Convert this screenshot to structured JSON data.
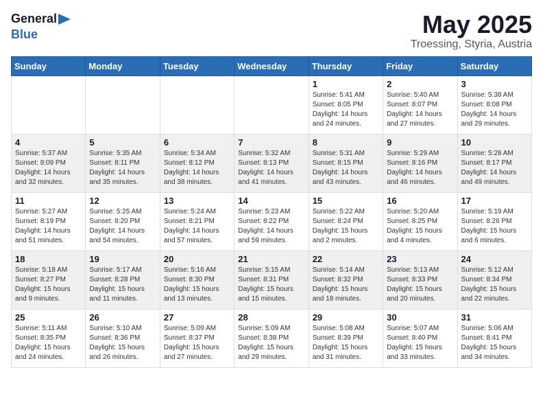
{
  "header": {
    "logo_general": "General",
    "logo_blue": "Blue",
    "month_title": "May 2025",
    "location": "Troessing, Styria, Austria"
  },
  "weekdays": [
    "Sunday",
    "Monday",
    "Tuesday",
    "Wednesday",
    "Thursday",
    "Friday",
    "Saturday"
  ],
  "weeks": [
    [
      {
        "day": "",
        "sunrise": "",
        "sunset": "",
        "daylight": ""
      },
      {
        "day": "",
        "sunrise": "",
        "sunset": "",
        "daylight": ""
      },
      {
        "day": "",
        "sunrise": "",
        "sunset": "",
        "daylight": ""
      },
      {
        "day": "",
        "sunrise": "",
        "sunset": "",
        "daylight": ""
      },
      {
        "day": "1",
        "sunrise": "Sunrise: 5:41 AM",
        "sunset": "Sunset: 8:05 PM",
        "daylight": "Daylight: 14 hours and 24 minutes."
      },
      {
        "day": "2",
        "sunrise": "Sunrise: 5:40 AM",
        "sunset": "Sunset: 8:07 PM",
        "daylight": "Daylight: 14 hours and 27 minutes."
      },
      {
        "day": "3",
        "sunrise": "Sunrise: 5:38 AM",
        "sunset": "Sunset: 8:08 PM",
        "daylight": "Daylight: 14 hours and 29 minutes."
      }
    ],
    [
      {
        "day": "4",
        "sunrise": "Sunrise: 5:37 AM",
        "sunset": "Sunset: 8:09 PM",
        "daylight": "Daylight: 14 hours and 32 minutes."
      },
      {
        "day": "5",
        "sunrise": "Sunrise: 5:35 AM",
        "sunset": "Sunset: 8:11 PM",
        "daylight": "Daylight: 14 hours and 35 minutes."
      },
      {
        "day": "6",
        "sunrise": "Sunrise: 5:34 AM",
        "sunset": "Sunset: 8:12 PM",
        "daylight": "Daylight: 14 hours and 38 minutes."
      },
      {
        "day": "7",
        "sunrise": "Sunrise: 5:32 AM",
        "sunset": "Sunset: 8:13 PM",
        "daylight": "Daylight: 14 hours and 41 minutes."
      },
      {
        "day": "8",
        "sunrise": "Sunrise: 5:31 AM",
        "sunset": "Sunset: 8:15 PM",
        "daylight": "Daylight: 14 hours and 43 minutes."
      },
      {
        "day": "9",
        "sunrise": "Sunrise: 5:29 AM",
        "sunset": "Sunset: 8:16 PM",
        "daylight": "Daylight: 14 hours and 46 minutes."
      },
      {
        "day": "10",
        "sunrise": "Sunrise: 5:28 AM",
        "sunset": "Sunset: 8:17 PM",
        "daylight": "Daylight: 14 hours and 49 minutes."
      }
    ],
    [
      {
        "day": "11",
        "sunrise": "Sunrise: 5:27 AM",
        "sunset": "Sunset: 8:19 PM",
        "daylight": "Daylight: 14 hours and 51 minutes."
      },
      {
        "day": "12",
        "sunrise": "Sunrise: 5:25 AM",
        "sunset": "Sunset: 8:20 PM",
        "daylight": "Daylight: 14 hours and 54 minutes."
      },
      {
        "day": "13",
        "sunrise": "Sunrise: 5:24 AM",
        "sunset": "Sunset: 8:21 PM",
        "daylight": "Daylight: 14 hours and 57 minutes."
      },
      {
        "day": "14",
        "sunrise": "Sunrise: 5:23 AM",
        "sunset": "Sunset: 8:22 PM",
        "daylight": "Daylight: 14 hours and 59 minutes."
      },
      {
        "day": "15",
        "sunrise": "Sunrise: 5:22 AM",
        "sunset": "Sunset: 8:24 PM",
        "daylight": "Daylight: 15 hours and 2 minutes."
      },
      {
        "day": "16",
        "sunrise": "Sunrise: 5:20 AM",
        "sunset": "Sunset: 8:25 PM",
        "daylight": "Daylight: 15 hours and 4 minutes."
      },
      {
        "day": "17",
        "sunrise": "Sunrise: 5:19 AM",
        "sunset": "Sunset: 8:26 PM",
        "daylight": "Daylight: 15 hours and 6 minutes."
      }
    ],
    [
      {
        "day": "18",
        "sunrise": "Sunrise: 5:18 AM",
        "sunset": "Sunset: 8:27 PM",
        "daylight": "Daylight: 15 hours and 9 minutes."
      },
      {
        "day": "19",
        "sunrise": "Sunrise: 5:17 AM",
        "sunset": "Sunset: 8:28 PM",
        "daylight": "Daylight: 15 hours and 11 minutes."
      },
      {
        "day": "20",
        "sunrise": "Sunrise: 5:16 AM",
        "sunset": "Sunset: 8:30 PM",
        "daylight": "Daylight: 15 hours and 13 minutes."
      },
      {
        "day": "21",
        "sunrise": "Sunrise: 5:15 AM",
        "sunset": "Sunset: 8:31 PM",
        "daylight": "Daylight: 15 hours and 15 minutes."
      },
      {
        "day": "22",
        "sunrise": "Sunrise: 5:14 AM",
        "sunset": "Sunset: 8:32 PM",
        "daylight": "Daylight: 15 hours and 18 minutes."
      },
      {
        "day": "23",
        "sunrise": "Sunrise: 5:13 AM",
        "sunset": "Sunset: 8:33 PM",
        "daylight": "Daylight: 15 hours and 20 minutes."
      },
      {
        "day": "24",
        "sunrise": "Sunrise: 5:12 AM",
        "sunset": "Sunset: 8:34 PM",
        "daylight": "Daylight: 15 hours and 22 minutes."
      }
    ],
    [
      {
        "day": "25",
        "sunrise": "Sunrise: 5:11 AM",
        "sunset": "Sunset: 8:35 PM",
        "daylight": "Daylight: 15 hours and 24 minutes."
      },
      {
        "day": "26",
        "sunrise": "Sunrise: 5:10 AM",
        "sunset": "Sunset: 8:36 PM",
        "daylight": "Daylight: 15 hours and 26 minutes."
      },
      {
        "day": "27",
        "sunrise": "Sunrise: 5:09 AM",
        "sunset": "Sunset: 8:37 PM",
        "daylight": "Daylight: 15 hours and 27 minutes."
      },
      {
        "day": "28",
        "sunrise": "Sunrise: 5:09 AM",
        "sunset": "Sunset: 8:38 PM",
        "daylight": "Daylight: 15 hours and 29 minutes."
      },
      {
        "day": "29",
        "sunrise": "Sunrise: 5:08 AM",
        "sunset": "Sunset: 8:39 PM",
        "daylight": "Daylight: 15 hours and 31 minutes."
      },
      {
        "day": "30",
        "sunrise": "Sunrise: 5:07 AM",
        "sunset": "Sunset: 8:40 PM",
        "daylight": "Daylight: 15 hours and 33 minutes."
      },
      {
        "day": "31",
        "sunrise": "Sunrise: 5:06 AM",
        "sunset": "Sunset: 8:41 PM",
        "daylight": "Daylight: 15 hours and 34 minutes."
      }
    ]
  ]
}
